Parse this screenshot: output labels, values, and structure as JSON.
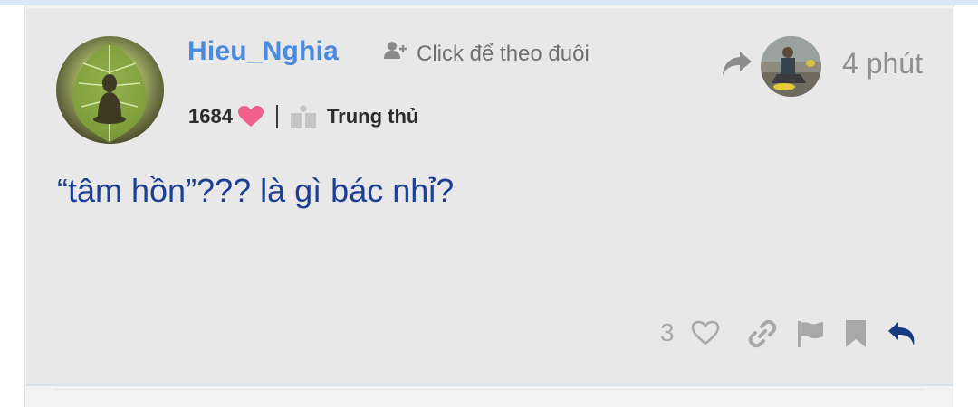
{
  "post": {
    "username": "Hieu_Nghia",
    "follow_label": "Click để theo đuôi",
    "likes_received": "1684",
    "title": "Trung thủ",
    "time": "4 phút",
    "content": "“tâm hồn”??? là gì bác nhỉ?",
    "like_count": "3"
  },
  "icons": {
    "follow": "user-plus-icon",
    "heart": "heart-icon",
    "title_badge": "book-icon",
    "reply_to": "share-arrow-icon",
    "like": "heart-outline-icon",
    "link": "link-icon",
    "flag": "flag-icon",
    "bookmark": "bookmark-icon",
    "reply": "reply-icon"
  },
  "colors": {
    "username": "#4a8be0",
    "content": "#1b3f92",
    "heart": "#f0608a",
    "reply_action": "#163a86"
  }
}
